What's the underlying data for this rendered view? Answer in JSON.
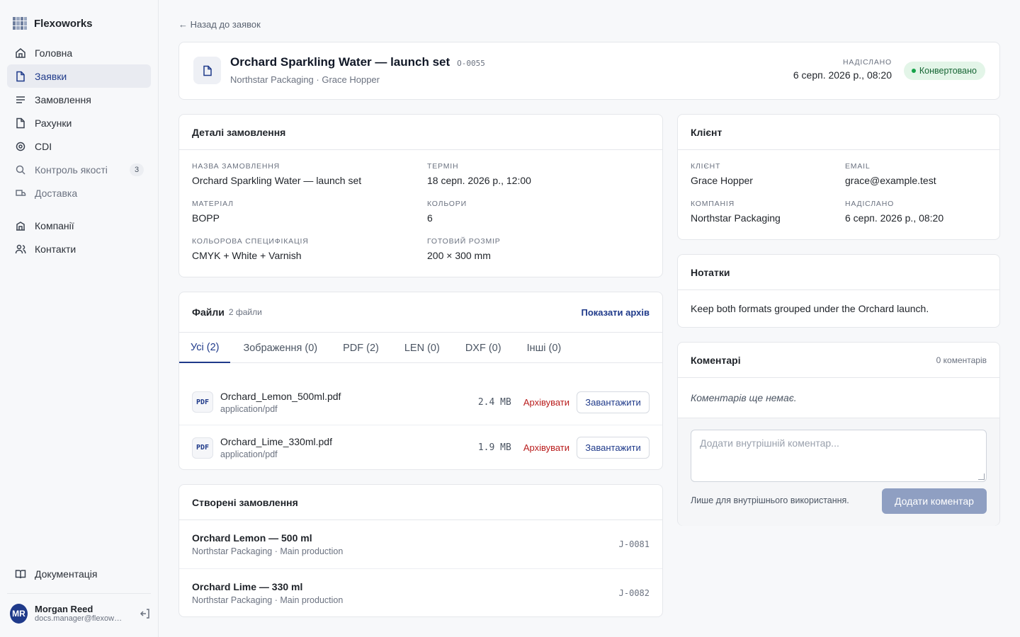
{
  "app": {
    "name": "Flexoworks"
  },
  "sidebar": {
    "main": [
      {
        "label": "Головна",
        "icon": "home-icon"
      },
      {
        "label": "Заявки",
        "icon": "file-icon",
        "active": true
      },
      {
        "label": "Замовлення",
        "icon": "list-icon"
      },
      {
        "label": "Рахунки",
        "icon": "file-icon"
      },
      {
        "label": "CDI",
        "icon": "target-icon"
      },
      {
        "label": "Контроль якості",
        "icon": "search-icon",
        "badge": "3",
        "muted": true
      },
      {
        "label": "Доставка",
        "icon": "truck-icon",
        "muted": true
      }
    ],
    "secondary": [
      {
        "label": "Компанії",
        "icon": "building-icon"
      },
      {
        "label": "Контакти",
        "icon": "users-icon"
      }
    ],
    "docs_label": "Документація",
    "user": {
      "initials": "MR",
      "name": "Morgan Reed",
      "email": "docs.manager@flexoworks.test"
    }
  },
  "back_label": "← Назад до заявок",
  "header": {
    "title": "Orchard Sparkling Water — launch set",
    "code": "O-0055",
    "subtitle": "Northstar Packaging · Grace Hopper",
    "sent_label": "НАДІСЛАНО",
    "sent_date": "6 серп. 2026 р., 08:20",
    "status": "Конвертовано"
  },
  "details": {
    "title": "Деталі замовлення",
    "fields": [
      {
        "label": "НАЗВА ЗАМОВЛЕННЯ",
        "value": "Orchard Sparkling Water — launch set"
      },
      {
        "label": "ТЕРМІН",
        "value": "18 серп. 2026 р., 12:00"
      },
      {
        "label": "МАТЕРІАЛ",
        "value": "BOPP"
      },
      {
        "label": "КОЛЬОРИ",
        "value": "6"
      },
      {
        "label": "КОЛЬОРОВА СПЕЦИФІКАЦІЯ",
        "value": "CMYK + White + Varnish"
      },
      {
        "label": "ГОТОВИЙ РОЗМІР",
        "value": "200 × 300 mm"
      }
    ]
  },
  "client": {
    "title": "Клієнт",
    "fields": [
      {
        "label": "КЛІЄНТ",
        "value": "Grace Hopper"
      },
      {
        "label": "EMAIL",
        "value": "grace@example.test"
      },
      {
        "label": "КОМПАНІЯ",
        "value": "Northstar Packaging"
      },
      {
        "label": "НАДІСЛАНО",
        "value": "6 серп. 2026 р., 08:20"
      }
    ]
  },
  "notes": {
    "title": "Нотатки",
    "text": "Keep both formats grouped under the Orchard launch."
  },
  "comments": {
    "title": "Коментарі",
    "count": "0 коментарів",
    "empty": "Коментарів ще немає.",
    "placeholder": "Додати внутрішній коментар...",
    "hint": "Лише для внутрішнього використання.",
    "submit": "Додати коментар"
  },
  "files": {
    "title": "Файли",
    "count": "2 файли",
    "archive_link": "Показати архів",
    "tabs": [
      "Усі (2)",
      "Зображення (0)",
      "PDF (2)",
      "LEN (0)",
      "DXF (0)",
      "Інші (0)"
    ],
    "active_tab": 0,
    "items": [
      {
        "type": "PDF",
        "name": "Orchard_Lemon_500ml.pdf",
        "mime": "application/pdf",
        "size": "2.4 MB",
        "archive": "Архівувати",
        "download": "Завантажити"
      },
      {
        "type": "PDF",
        "name": "Orchard_Lime_330ml.pdf",
        "mime": "application/pdf",
        "size": "1.9 MB",
        "archive": "Архівувати",
        "download": "Завантажити"
      }
    ]
  },
  "orders": {
    "title": "Створені замовлення",
    "items": [
      {
        "title": "Orchard Lemon — 500 ml",
        "sub": "Northstar Packaging · Main production",
        "code": "J-0081"
      },
      {
        "title": "Orchard Lime — 330 ml",
        "sub": "Northstar Packaging · Main production",
        "code": "J-0082"
      }
    ]
  },
  "colors": {
    "accent": "#1f3a8a",
    "danger": "#b91c1c",
    "success": "#16a34a"
  }
}
